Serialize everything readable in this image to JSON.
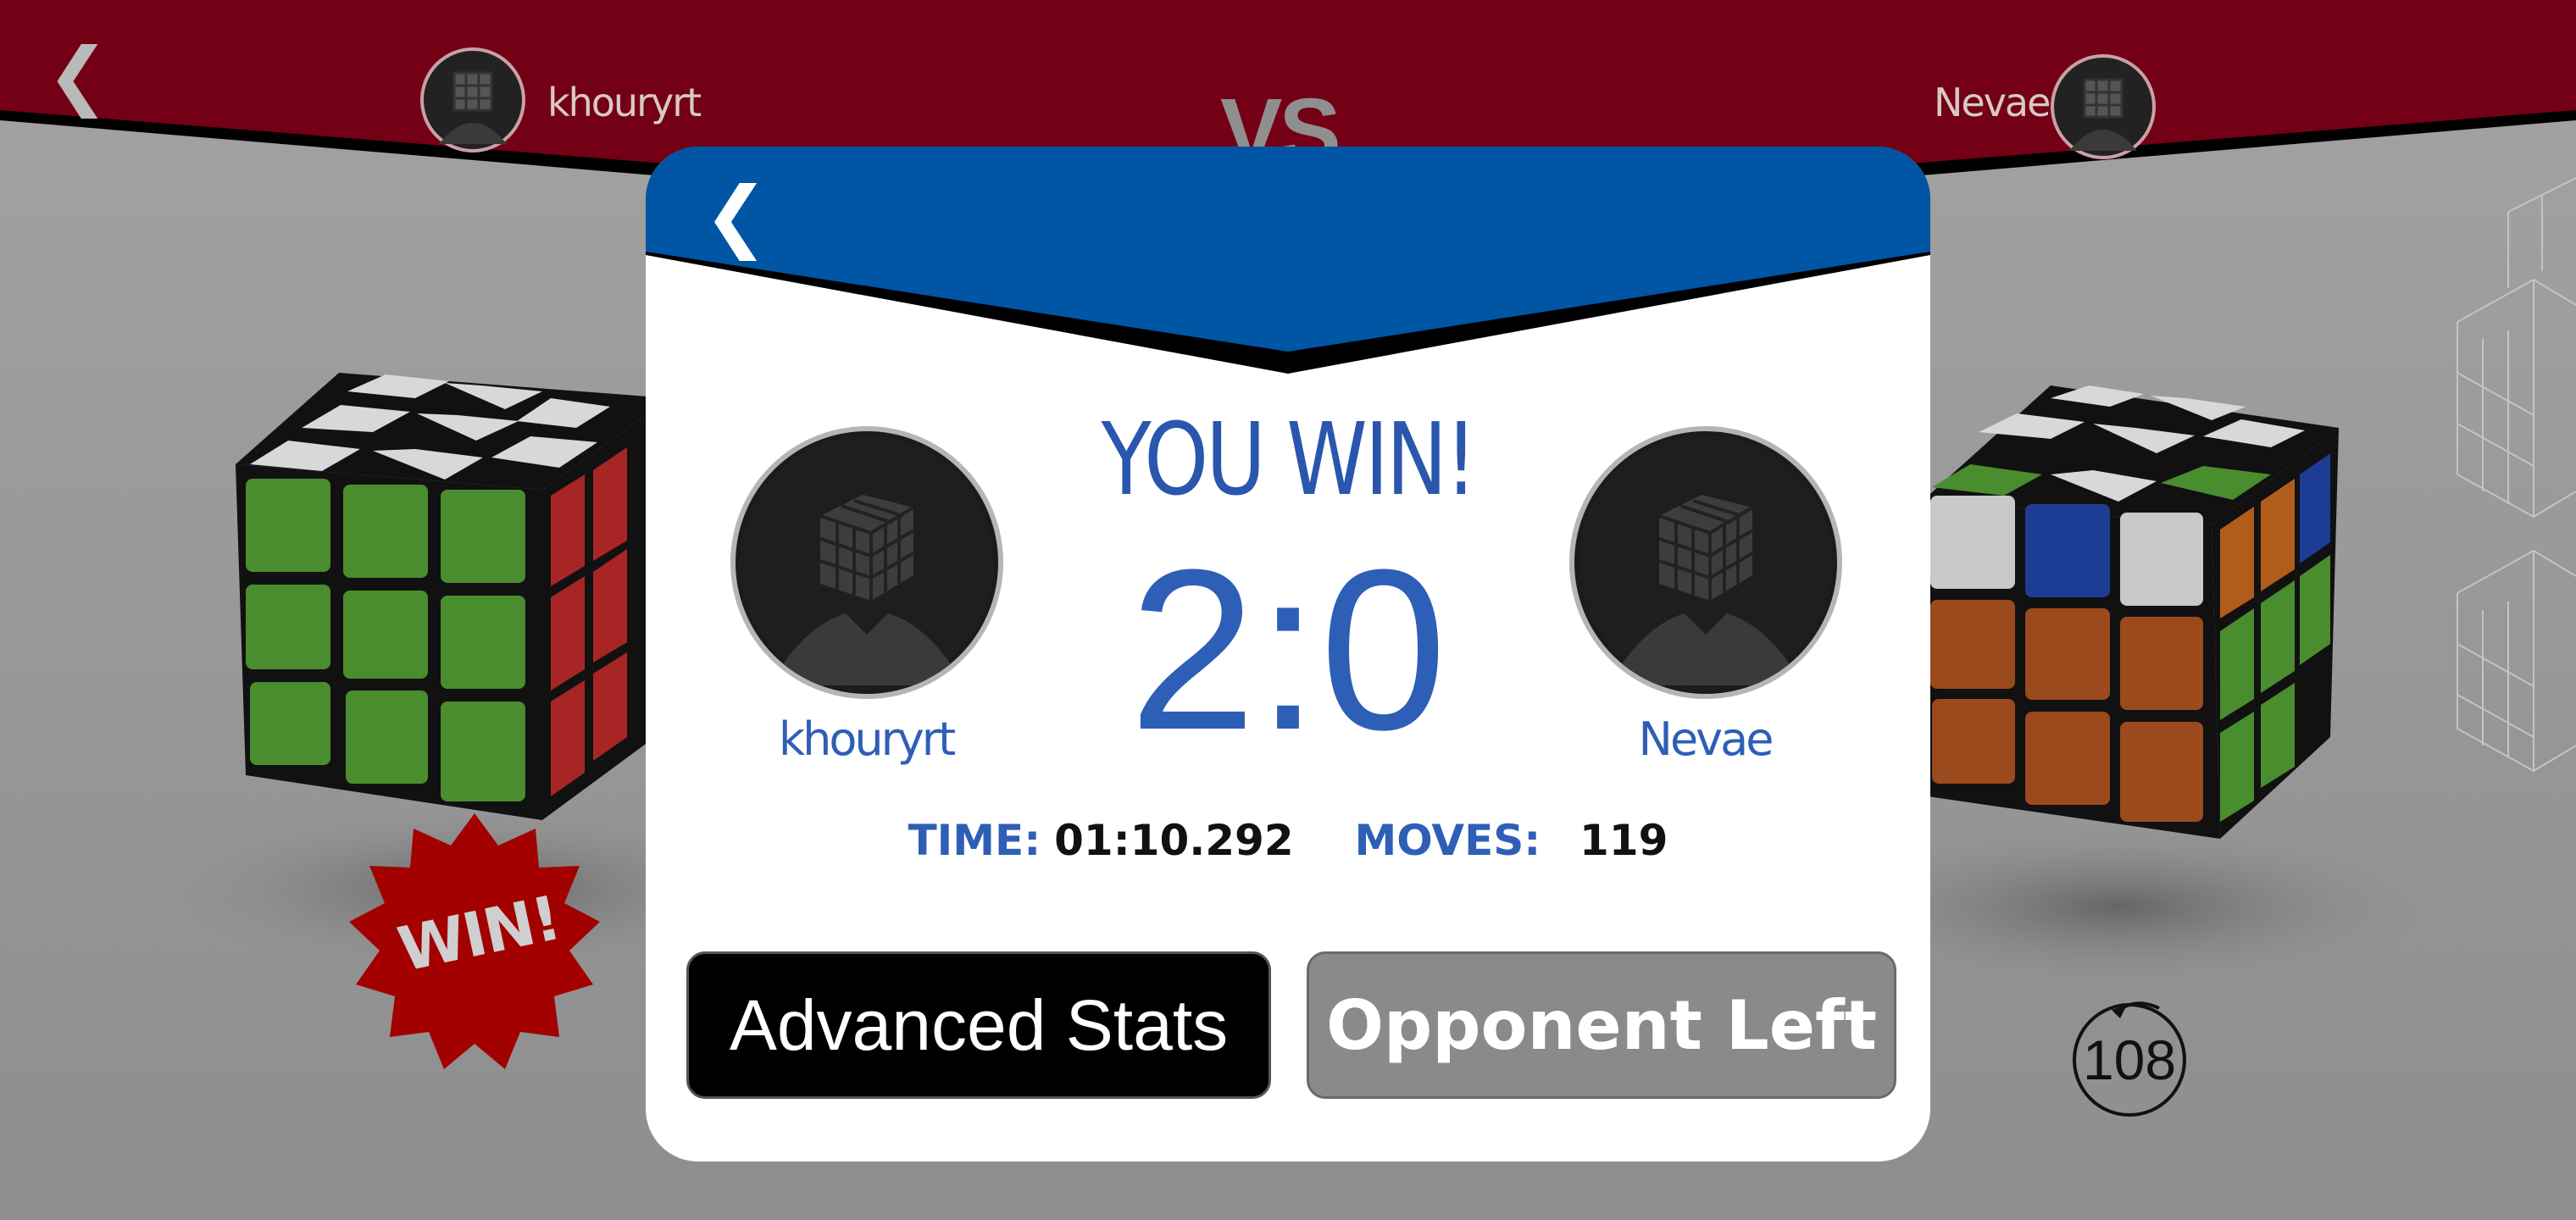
{
  "header": {
    "back_glyph": "❮",
    "player_left": "khouryrt",
    "player_right": "Nevae",
    "vs_text": "VS"
  },
  "modal": {
    "back_glyph": "❮",
    "result_title": "YOU WIN!",
    "score": "2:0",
    "player_left": "khouryrt",
    "player_right": "Nevae",
    "stats": {
      "time_label": "TIME:",
      "time_value": "01:10.292",
      "moves_label": "MOVES:",
      "moves_value": "119"
    },
    "advanced_stats_label": "Advanced Stats",
    "opponent_left_label": "Opponent Left"
  },
  "badge": {
    "win_text": "WIN!"
  },
  "move_counter": "108",
  "colors": {
    "header_red": "#730015",
    "modal_blue": "#0055a4",
    "accent_blue": "#2e5fb6",
    "background_gray": "#9a9a9a",
    "win_badge_red": "#a30000"
  },
  "icons": [
    "back-chevron-icon",
    "cube-avatar-icon",
    "undo-counter-icon"
  ]
}
